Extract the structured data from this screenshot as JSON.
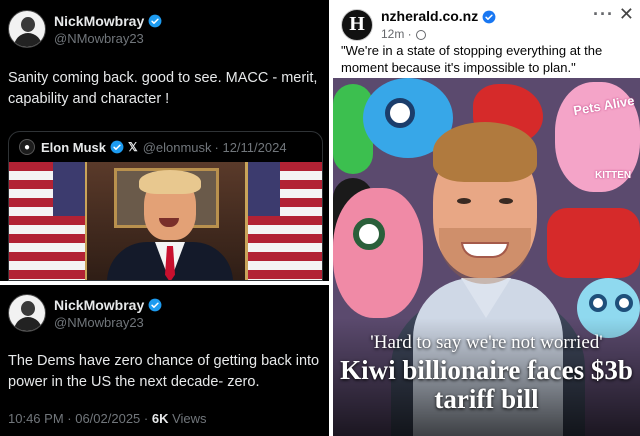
{
  "tweet1": {
    "display_name": "NickMowbray",
    "handle": "@NMowbray23",
    "text": "Sanity coming back. good to see. MACC - merit, capability and character !",
    "quote": {
      "display_name": "Elon Musk",
      "x_badge": "𝕏",
      "handle": "@elonmusk",
      "date": "· 12/11/2024"
    }
  },
  "tweet2": {
    "display_name": "NickMowbray",
    "handle": "@NMowbray23",
    "text": "The Dems have zero chance of getting back into power in the US the next decade- zero.",
    "time": "10:46 PM",
    "date": "· 06/02/2025 ·",
    "views_count": "6K",
    "views_label": "Views"
  },
  "nzpost": {
    "page_name": "nzherald.co.nz",
    "time": "12m ·",
    "caption": "\"We're in a state of stopping everything at the moment because it's impossible to plan.\"",
    "kicker": "'Hard to say we're not worried'",
    "headline": "Kiwi billionaire faces $3b tariff bill",
    "toy_label_1": "Pets Alive",
    "toy_label_2": "KITTEN",
    "logo_glyph": "H"
  },
  "colors": {
    "x_background": "#000000",
    "verified_blue": "#1d9bf0",
    "secondary_text": "#71767b"
  },
  "icons": [
    "verified-badge-icon",
    "x-logo-icon",
    "globe-icon",
    "more-icon",
    "close-icon"
  ]
}
